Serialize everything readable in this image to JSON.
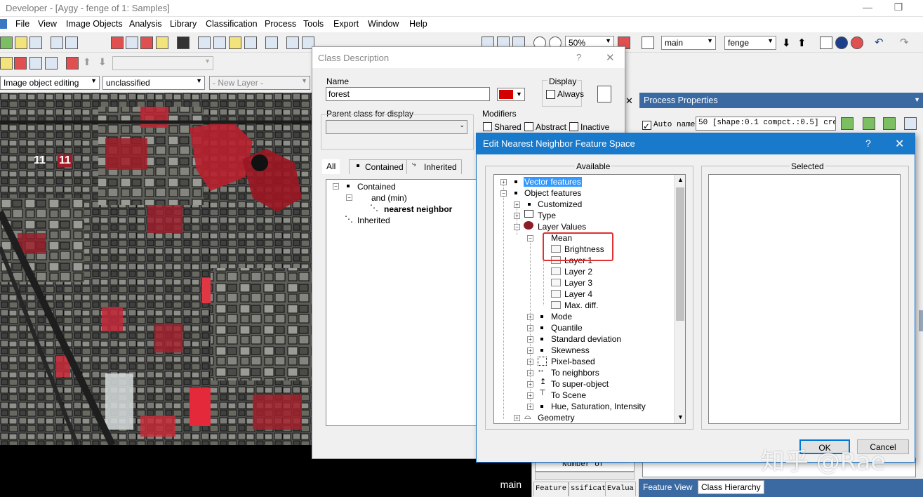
{
  "window": {
    "title": "Developer - [Aygy - fenge of 1: Samples]"
  },
  "menu": [
    "File",
    "View",
    "Image Objects",
    "Analysis",
    "Library",
    "Classification",
    "Process",
    "Tools",
    "Export",
    "Window",
    "Help"
  ],
  "toolbar": {
    "zoom": "50%",
    "image_layer": "main",
    "map": "fenge"
  },
  "toolbar3": {
    "mode": "Image object editing",
    "class": "unclassified",
    "layer": "- New Layer -"
  },
  "map": {
    "label": "main",
    "tag_a": "11",
    "tag_b": "11"
  },
  "class_desc": {
    "title": "Class Description",
    "help": "?",
    "name_label": "Name",
    "name_value": "forest",
    "color": "#d40000",
    "display_label": "Display",
    "always_label": "Always",
    "parent_label": "Parent class for display",
    "modifiers_label": "Modifiers",
    "shared": "Shared",
    "abstract": "Abstract",
    "inactive": "Inactive",
    "tabs": [
      "All",
      "Contained",
      "Inherited"
    ],
    "tree": {
      "contained": "Contained",
      "and_min": "and (min)",
      "nn": "nearest neighbor",
      "inherited": "Inherited"
    }
  },
  "process_props": {
    "title": "Process Properties",
    "auto_name": "Auto name",
    "process_text": "50 [shape:0.1 compct.:0.5] creati",
    "status_number": "Number of ...",
    "left_tabs": [
      "Feature",
      "ssificat",
      "Evalua"
    ],
    "bottom_tabs": [
      "Feature View",
      "Class Hierarchy"
    ]
  },
  "nn_dialog": {
    "title": "Edit Nearest Neighbor Feature Space",
    "help": "?",
    "available": "Available",
    "selected": "Selected",
    "tree": [
      "Vector features",
      "Object features",
      "Customized",
      "Type",
      "Layer Values",
      "Mean",
      "Brightness",
      "Layer 1",
      "Layer 2",
      "Layer 3",
      "Layer 4",
      "Max. diff.",
      "Mode",
      "Quantile",
      "Standard deviation",
      "Skewness",
      "Pixel-based",
      "To neighbors",
      "To super-object",
      "To Scene",
      "Hue, Saturation, Intensity",
      "Geometry"
    ],
    "ok": "OK",
    "cancel": "Cancel"
  },
  "watermark": "知乎 @Rae",
  "colors": {
    "nn_header": "#1979ca",
    "highlight_box": "#e03030",
    "selection": "#3399ff"
  }
}
